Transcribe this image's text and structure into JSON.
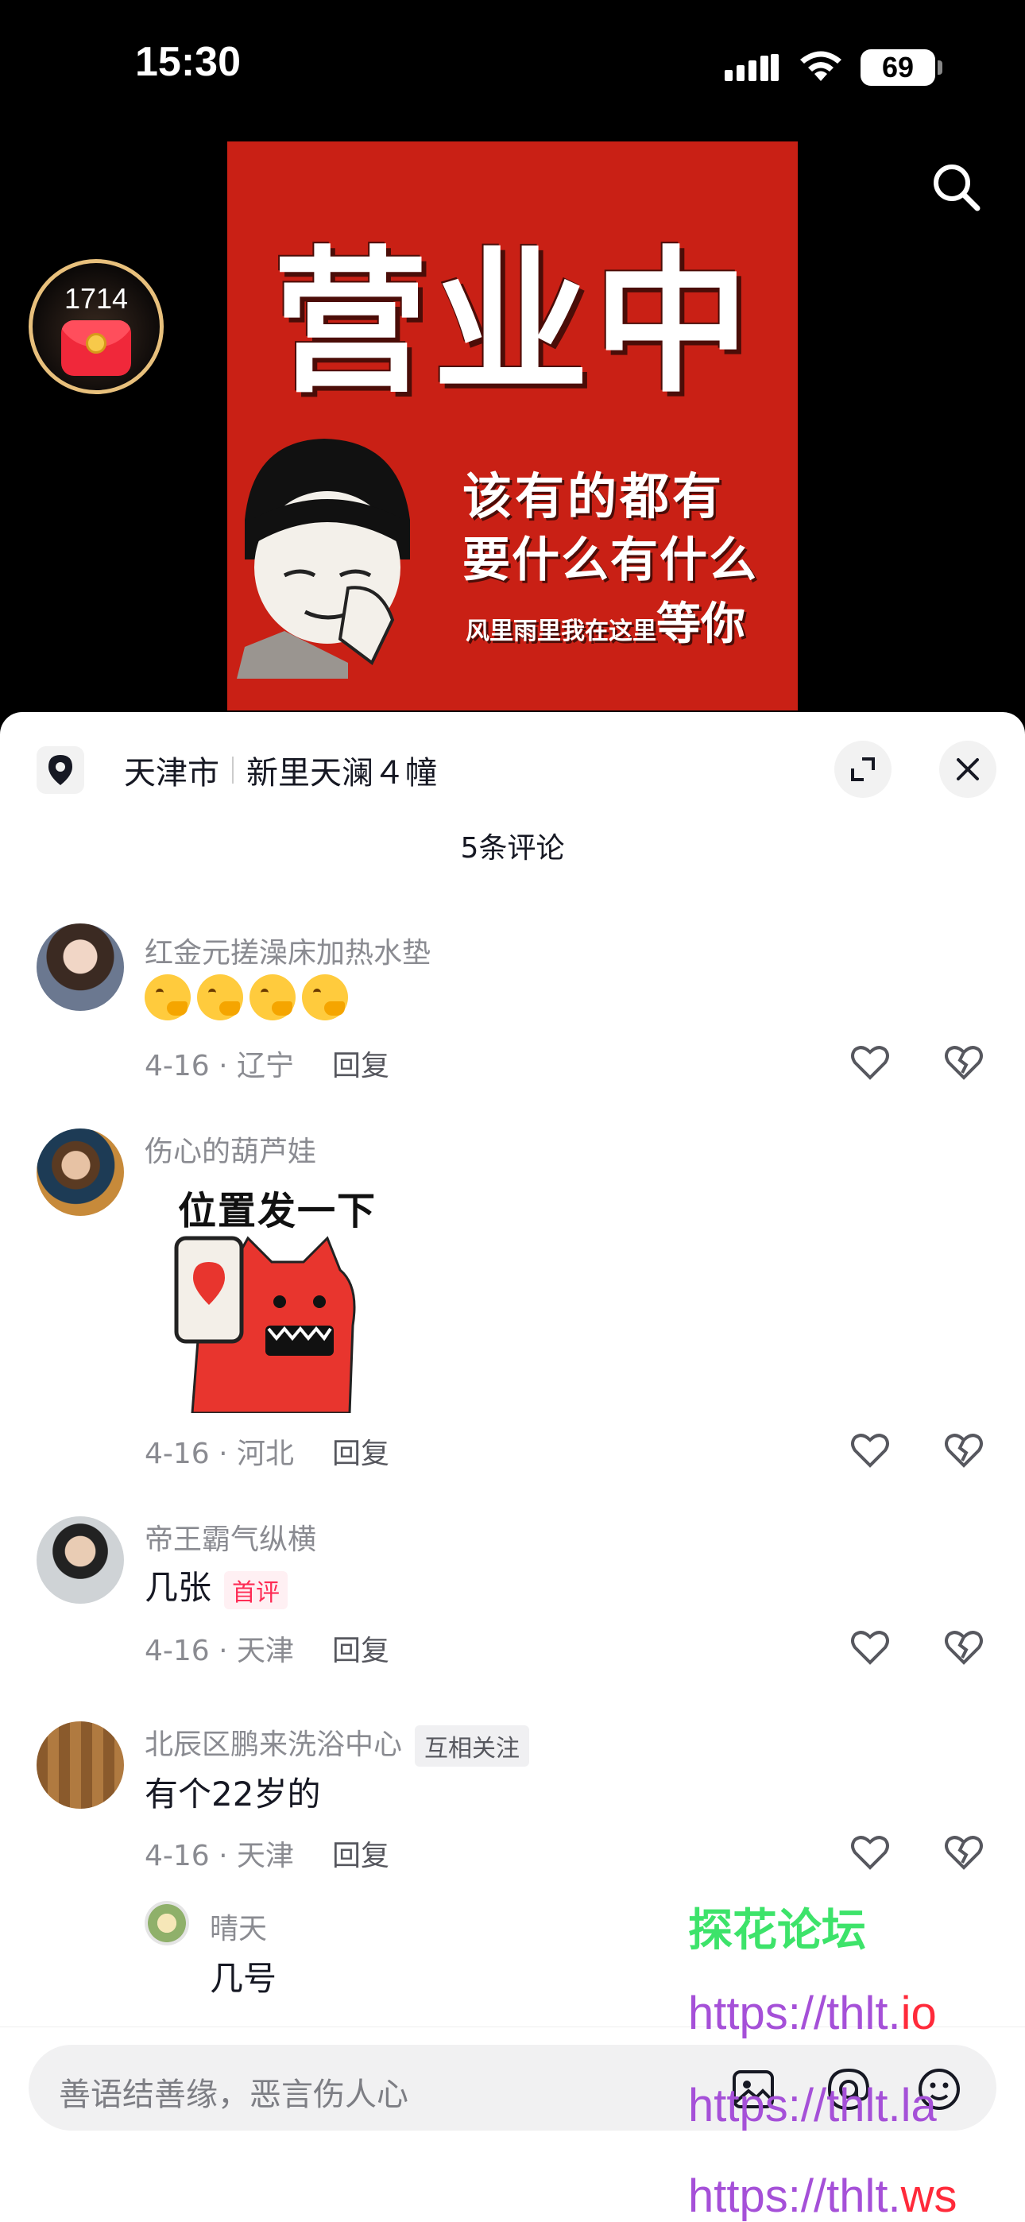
{
  "status_bar": {
    "time": "15:30",
    "battery": "69"
  },
  "red_packet": {
    "count": "1714"
  },
  "poster": {
    "headline": "营业中",
    "line1": "该有的都有",
    "line2": "要什么有什么",
    "line3_small": "风里雨里我在这里",
    "line3_big": "等你"
  },
  "sheet": {
    "city": "天津市",
    "place": "新里天澜４幢",
    "comment_count": "5条评论"
  },
  "comments": [
    {
      "user": "红金元搓澡床加热水垫",
      "text": "",
      "emojis": 4,
      "date_loc": "4-16 · 辽宁",
      "reply": "回复"
    },
    {
      "user": "伤心的葫芦娃",
      "sticker_text": "位置发一下",
      "date_loc": "4-16 · 河北",
      "reply": "回复"
    },
    {
      "user": "帝王霸气纵横",
      "text": "几张",
      "badge": "首评",
      "date_loc": "4-16 · 天津",
      "reply": "回复"
    },
    {
      "user": "北辰区鹏来洗浴中心",
      "badge": "互相关注",
      "text": "有个22岁的",
      "date_loc": "4-16 · 天津",
      "reply": "回复"
    }
  ],
  "sub_reply": {
    "user": "晴天",
    "text": "几号"
  },
  "input": {
    "placeholder": "善语结善缘，恶言伤人心"
  },
  "watermark": {
    "title": "探花论坛",
    "url1_prefix": "https://thlt.",
    "url1_tld": "io",
    "url2_prefix": "https://thlt.",
    "url2_tld": "la",
    "url3_prefix": "https://thlt.",
    "url3_tld": "ws"
  }
}
